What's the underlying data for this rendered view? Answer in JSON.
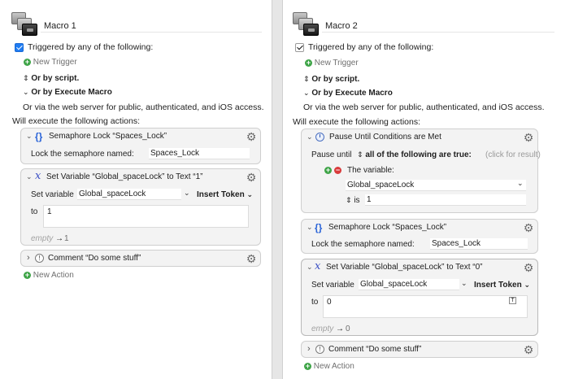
{
  "left": {
    "macro_name": "Macro 1",
    "triggered_by": "Triggered by any of the following:",
    "new_trigger": "New Trigger",
    "or_by_script": "Or by script.",
    "or_by_execute": "Or by Execute Macro",
    "web_server": "Or via the web server for public, authenticated, and iOS access.",
    "will_execute": "Will execute the following actions:",
    "semaphore": {
      "title": "Semaphore Lock “Spaces_Lock”",
      "label": "Lock the semaphore named:",
      "value": "Spaces_Lock"
    },
    "setvar": {
      "title": "Set Variable “Global_spaceLock” to Text “1”",
      "set_label": "Set variable",
      "var_name": "Global_spaceLock",
      "insert_token": "Insert Token",
      "to_label": "to",
      "to_value": "1",
      "preview_empty": "empty",
      "preview_arrow": "→",
      "preview_value": "1"
    },
    "comment": {
      "title": "Comment “Do some stuff”"
    },
    "new_action": "New Action"
  },
  "right": {
    "macro_name": "Macro 2",
    "triggered_by": "Triggered by any of the following:",
    "new_trigger": "New Trigger",
    "or_by_script": "Or by script.",
    "or_by_execute": "Or by Execute Macro",
    "web_server": "Or via the web server for public, authenticated, and iOS access.",
    "will_execute": "Will execute the following actions:",
    "pause": {
      "title": "Pause Until Conditions are Met",
      "pause_until": "Pause until",
      "all_of": "all of the following are true:",
      "click_hint": "(click for result)",
      "the_variable": "The variable:",
      "var_name": "Global_spaceLock",
      "is_label": "is",
      "is_value": "1"
    },
    "semaphore": {
      "title": "Semaphore Lock “Spaces_Lock”",
      "label": "Lock the semaphore named:",
      "value": "Spaces_Lock"
    },
    "setvar": {
      "title": "Set Variable “Global_spaceLock” to Text “0”",
      "set_label": "Set variable",
      "var_name": "Global_spaceLock",
      "insert_token": "Insert Token",
      "to_label": "to",
      "to_value": "0",
      "t_badge": "T",
      "preview_empty": "empty",
      "preview_arrow": "→",
      "preview_value": "0"
    },
    "comment": {
      "title": "Comment “Do some stuff”"
    },
    "new_action": "New Action"
  },
  "icons": {
    "gear": "⚙",
    "chev_down": "⌄",
    "chev_right": "›",
    "updown": "⇕",
    "popup": "⌵",
    "brace": "{}",
    "x": "x",
    "excl": "!",
    "plus": "+",
    "minus": "−"
  },
  "colors": {
    "accent": "#1f7cf2",
    "green": "#3ea447",
    "red": "#d93b3b"
  }
}
